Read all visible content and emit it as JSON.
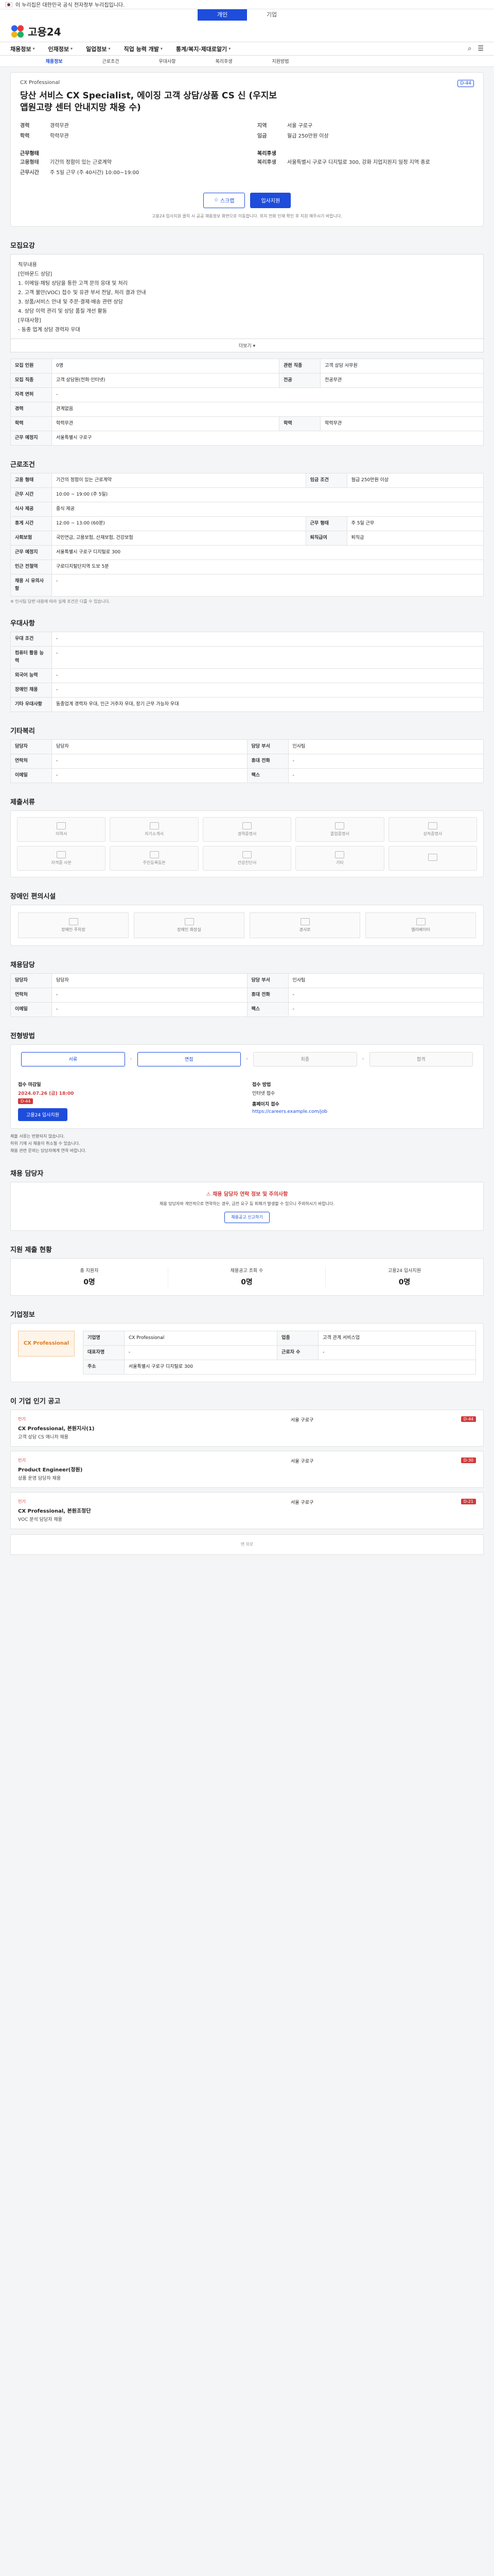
{
  "topbar": {
    "text": "이 누리집은 대한민국 공식 전자정부 누리집입니다."
  },
  "service_tabs": [
    "개인",
    "기업"
  ],
  "logo": {
    "text": "고용24"
  },
  "gnb": {
    "items": [
      "채용정보",
      "인재정보",
      "일업정보",
      "직업 능력 개발",
      "통계/복지·제대로알기"
    ],
    "menu_icon": "menu-icon",
    "search_icon": "search-icon"
  },
  "subnav": [
    "채용정보",
    "근로조건",
    "우대사항",
    "복리후생",
    "지원방법"
  ],
  "header": {
    "company": "CX Professional",
    "dday": "D-44",
    "title": "당산 서비스 CX Specialist, 에이징 고객 상담/상품 CS 신 (우지보 앱원고량 센터 안내지망 채용 수)",
    "fields": [
      {
        "k": "경력",
        "v": "경력무관"
      },
      {
        "k": "학력",
        "v": "학력무관"
      },
      {
        "k": "지역",
        "v": "서울 구로구"
      },
      {
        "k": "임금",
        "v": "월급 250만원 이상"
      }
    ],
    "sec1_title": "근무형태",
    "sec1_fields": [
      {
        "k": "고용형태",
        "v": "기간의 정함이 있는 근로계약"
      },
      {
        "k": "근무시간",
        "v": "주 5일 근무 (주 40시간) 10:00~19:00"
      }
    ],
    "sec2_title": "복리후생",
    "sec2_fields": [
      {
        "k": "복리후생",
        "v": "서울특별시 구로구 디지털로 300, 강화 지업지원지 일정 지역 종로"
      }
    ],
    "btn_scrap": "스크랩",
    "btn_apply": "입사지원",
    "notice": "고용24 입사지원 클릭 시 공공 채용정보 화면으로 이동합니다. 위치 전화 인재 확인 후 지원 해주시기 바랍니다."
  },
  "sections": {
    "recruit": "모집요강",
    "conditions": "근로조건",
    "preference": "우대사항",
    "documents": "제출서류",
    "welfare": "기타복리",
    "facilities": "장애인 편의시설",
    "manager": "채용담당",
    "process": "전형방법",
    "method": "채용 담당자",
    "inquiry": "지원 제출 현황",
    "company": "기업정보",
    "recommend": "이 기업 인기 공고"
  },
  "recruit": {
    "desc_lines": [
      "직무내용",
      "[인바운드 상담]",
      "1. 이메일·채팅 상담을 통한 고객 문의 응대 및 처리",
      "2. 고객 불만(VOC) 접수 및 유관 부서 전달, 처리 결과 안내",
      "3. 상품/서비스 안내 및 주문·결제·배송 관련 상담",
      "4. 상담 이력 관리 및 상담 품질 개선 활동",
      "[우대사항]",
      "- 동종 업계 상담 경력자 우대"
    ],
    "more_label": "더보기",
    "table": [
      {
        "k": "모집 인원",
        "v": "0명",
        "k2": "관련 직종",
        "v2": "고객 상담 사무원"
      },
      {
        "k": "모집 직종",
        "v": "고객 상담원(전화·인터넷)",
        "k2": "전공",
        "v2": "전공무관"
      },
      {
        "k": "자격 면허",
        "v": "-",
        "k2": "",
        "v2": ""
      },
      {
        "k": "경력",
        "v": "관계없음",
        "k2": "",
        "v2": ""
      },
      {
        "k": "학력",
        "v": "학력무관",
        "k2": "학력",
        "v2": "학력무관"
      },
      {
        "k": "근무 예정지",
        "v": "서울특별시 구로구",
        "k2": "",
        "v2": ""
      }
    ]
  },
  "conditions": {
    "table": [
      {
        "k": "고용 형태",
        "v": "기간의 정함이 있는 근로계약",
        "k2": "임금 조건",
        "v2": "월급 250만원 이상"
      },
      {
        "k": "근무 시간",
        "v": "10:00 ~ 19:00 (주 5일)",
        "k2": "",
        "v2": ""
      },
      {
        "k": "식사 제공",
        "v": "중식 제공",
        "k2": "",
        "v2": ""
      },
      {
        "k": "휴게 시간",
        "v": "12:00 ~ 13:00 (60분)",
        "k2": "근무 형태",
        "v2": "주 5일 근무"
      },
      {
        "k": "사회보험",
        "v": "국민연금, 고용보험, 산재보험, 건강보험",
        "k2": "퇴직급여",
        "v2": "퇴직금"
      },
      {
        "k": "근무 예정지",
        "v": "서울특별시 구로구 디지털로 300",
        "k2": "",
        "v2": ""
      },
      {
        "k": "인근 전철역",
        "v": "구로디지털단지역 도보 5분",
        "k2": "",
        "v2": ""
      },
      {
        "k": "채용 시 유의사항",
        "v": "-",
        "k2": "",
        "v2": ""
      }
    ],
    "ref": "※ 인사팀 답변 내용에 따라 실제 조건은 다를 수 있습니다."
  },
  "preference": {
    "table": [
      {
        "k": "우대 조건",
        "v": "-"
      },
      {
        "k": "컴퓨터 활용 능력",
        "v": "-"
      },
      {
        "k": "외국어 능력",
        "v": "-"
      },
      {
        "k": "장애인 채용",
        "v": "-"
      },
      {
        "k": "기타 우대사항",
        "v": "동종업계 경력자 우대, 인근 거주자 우대, 장기 근무 가능자 우대"
      }
    ]
  },
  "manager": {
    "table": [
      {
        "k": "담당자",
        "v": "담당자",
        "k2": "담당 부서",
        "v2": "인사팀"
      },
      {
        "k": "연락처",
        "v": "-",
        "k2": "휴대 전화",
        "v2": "-"
      },
      {
        "k": "이메일",
        "v": "-",
        "k2": "팩스",
        "v2": "-"
      }
    ]
  },
  "documents": {
    "items": [
      "이력서",
      "자기소개서",
      "경력증명서",
      "졸업증명서",
      "성적증명서",
      "자격증 사본",
      "주민등록등본",
      "건강진단서",
      "기타",
      ""
    ]
  },
  "facilities": {
    "items": [
      "장애인 주차장",
      "장애인 화장실",
      "경사로",
      "엘리베이터"
    ]
  },
  "process": {
    "steps": [
      "서류",
      "면접",
      "최종",
      "합격"
    ],
    "method_left_label": "접수 마감일",
    "method_left_value": "2024.07.26 (금) 18:00",
    "method_right_label": "접수 방법",
    "method_right_value": "인터넷 접수",
    "badge": "D-44",
    "apply_btn": "고용24 입사지원",
    "url_label": "홈페이지 접수",
    "url_value": "https://careers.example.com/job",
    "notes": [
      "제출 서류는 반환되지 않습니다.",
      "허위 기재 시 채용이 취소될 수 있습니다.",
      "채용 관련 문의는 담당자에게 연락 바랍니다."
    ]
  },
  "warning": {
    "head": "채용 담당자 연락 정보 및 주의사항",
    "text": "채용 담당자와 개인적으로 연락하는 경우, 금전 요구 등 피해가 발생할 수 있으니 주의하시기 바랍니다.",
    "btn": "채용공고 신고하기"
  },
  "inquiry": {
    "labels": [
      "총 지원자",
      "채용공고 조회 수",
      "고용24 입사지원"
    ],
    "values": [
      "0명",
      "0명",
      "0명"
    ]
  },
  "company": {
    "name": "CX Professional",
    "table": [
      {
        "k": "기업명",
        "v": "CX Professional",
        "k2": "업종",
        "v2": "고객 관계 서비스업"
      },
      {
        "k": "대표자명",
        "v": "-",
        "k2": "근로자 수",
        "v2": "-"
      },
      {
        "k": "주소",
        "v": "서울특별시 구로구 디지털로 300",
        "k2": "",
        "v2": ""
      }
    ]
  },
  "recommend": {
    "items": [
      {
        "tag": "인기",
        "company": "CX Professional, 본원지사(1)",
        "title": "고객 상담 CS 매니저 채용",
        "cond": "서울 구로구",
        "deadline": "D-44"
      },
      {
        "tag": "인기",
        "company": "Product Engineer(정원)",
        "title": "상품 운영 담당자 채용",
        "cond": "서울 구로구",
        "deadline": "D-30"
      },
      {
        "tag": "인기",
        "company": "CX Professional, 본원조정단",
        "title": "VOC 분석 담당자 채용",
        "cond": "서울 구로구",
        "deadline": "D-21"
      }
    ]
  },
  "footer": {
    "text": "맨 위로"
  }
}
